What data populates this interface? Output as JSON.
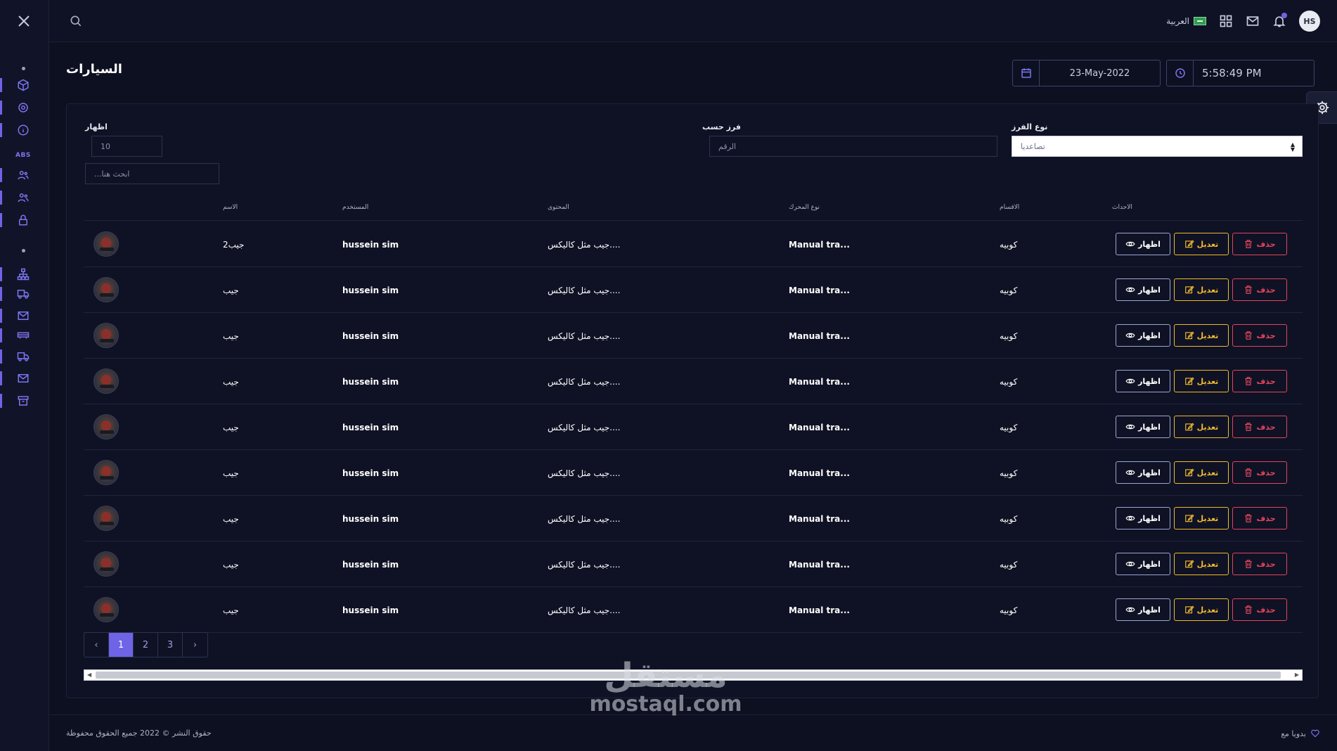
{
  "topbar": {
    "language_label": "العربية",
    "avatar_initials": "HS"
  },
  "page": {
    "title": "السيارات",
    "date": "23-May-2022",
    "time": "5:58:49 PM"
  },
  "sidebar": {
    "section_label": "ABS",
    "items": [
      {
        "icon": "cube-icon"
      },
      {
        "icon": "gear-icon"
      },
      {
        "icon": "info-icon"
      },
      {
        "icon": "users-icon"
      },
      {
        "icon": "users-icon"
      },
      {
        "icon": "lock-icon"
      },
      {
        "icon": "sitemap-icon"
      },
      {
        "icon": "truck-icon"
      },
      {
        "icon": "mail-icon"
      },
      {
        "icon": "bus-icon"
      },
      {
        "icon": "truck-icon"
      },
      {
        "icon": "mail-icon"
      },
      {
        "icon": "archive-icon"
      }
    ]
  },
  "filters": {
    "show_label": "اظهار",
    "show_value": "10",
    "search_placeholder": "ابحث هنا...",
    "sort_by_label": "فرز حسب",
    "sort_by_placeholder": "الرقم",
    "sort_type_label": "نوع الفرز",
    "sort_type_value": "تصاعديا"
  },
  "table": {
    "columns": {
      "name": "الاسم",
      "user": "المستخدم",
      "content": "المحتوى",
      "engine": "نوع المحرك",
      "sections": "الاقسام",
      "actions": "الاحداث"
    },
    "rows": [
      {
        "name": "جيب2",
        "user": "hussein sim",
        "content": "جيب مثل كاليكس....",
        "engine": "Manual tra...",
        "section": "كوبيه"
      },
      {
        "name": "جيب",
        "user": "hussein sim",
        "content": "جيب مثل كاليكس....",
        "engine": "Manual tra...",
        "section": "كوبيه"
      },
      {
        "name": "جيب",
        "user": "hussein sim",
        "content": "جيب مثل كاليكس....",
        "engine": "Manual tra...",
        "section": "كوبيه"
      },
      {
        "name": "جيب",
        "user": "hussein sim",
        "content": "جيب مثل كاليكس....",
        "engine": "Manual tra...",
        "section": "كوبيه"
      },
      {
        "name": "جيب",
        "user": "hussein sim",
        "content": "جيب مثل كاليكس....",
        "engine": "Manual tra...",
        "section": "كوبيه"
      },
      {
        "name": "جيب",
        "user": "hussein sim",
        "content": "جيب مثل كاليكس....",
        "engine": "Manual tra...",
        "section": "كوبيه"
      },
      {
        "name": "جيب",
        "user": "hussein sim",
        "content": "جيب مثل كاليكس....",
        "engine": "Manual tra...",
        "section": "كوبيه"
      },
      {
        "name": "جيب",
        "user": "hussein sim",
        "content": "جيب مثل كاليكس....",
        "engine": "Manual tra...",
        "section": "كوبيه"
      },
      {
        "name": "جيب",
        "user": "hussein sim",
        "content": "جيب مثل كاليكس....",
        "engine": "Manual tra...",
        "section": "كوبيه"
      }
    ],
    "actions": {
      "view": "اظهار",
      "edit": "تعديل",
      "delete": "حذف"
    }
  },
  "pagination": {
    "prev": "‹",
    "pages": [
      "1",
      "2",
      "3"
    ],
    "next": "›",
    "active": "1"
  },
  "footer": {
    "copyright": "حقوق النشر © 2022 جميع الحقوق محفوظة",
    "made_with": "بدويا مع"
  },
  "watermark": {
    "arabic": "مستقل",
    "latin": "mostaql.com"
  },
  "colors": {
    "accent": "#6f63e6",
    "edit": "#f0b92e",
    "delete": "#e0455e",
    "background": "#0d1020"
  }
}
